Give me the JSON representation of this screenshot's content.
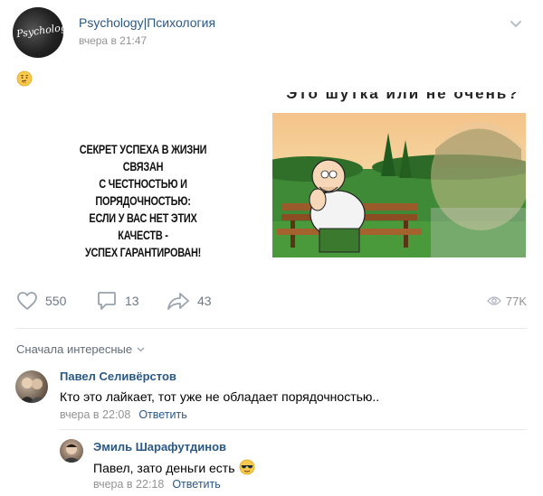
{
  "post": {
    "group_name": "Psychology|Психология",
    "avatar_text": "Psychology",
    "time": "вчера в 21:47",
    "emoji": "thinking-face-icon",
    "meme": {
      "left_text": [
        "СЕКРЕТ УСПЕХА В ЖИЗНИ СВЯЗАН",
        "С ЧЕСТНОСТЬЮ И ПОРЯДОЧНОСТЬЮ:",
        "ЕСЛИ У ВАС НЕТ ЭТИХ КАЧЕСТВ -",
        "УСПЕХ ГАРАНТИРОВАН!"
      ],
      "top_caption": "Это шутка или не очень?"
    }
  },
  "actions": {
    "likes": "550",
    "comments": "13",
    "shares": "43",
    "views": "77K"
  },
  "comments_sort": "Сначала интересные",
  "comments": [
    {
      "author": "Павел Селивёрстов",
      "text": "Кто это лайкает, тот уже не обладает порядочностью..",
      "time": "вчера в 22:08",
      "reply_label": "Ответить"
    },
    {
      "author": "Эмиль Шарафутдинов",
      "text": "Павел, зато деньги есть",
      "emoji": "cool-sunglasses-icon",
      "time": "вчера в 22:18",
      "reply_label": "Ответить"
    }
  ],
  "colors": {
    "link": "#2a5885",
    "meta": "#939393",
    "icon": "#6d7885"
  }
}
